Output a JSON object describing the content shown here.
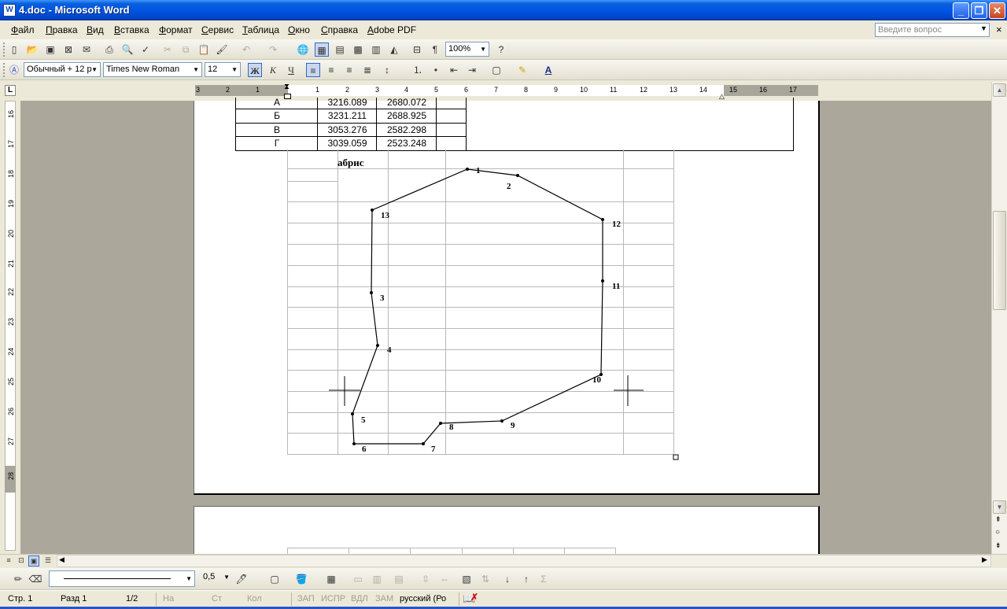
{
  "window": {
    "title": "4.doc - Microsoft Word",
    "icon": "W",
    "controls": [
      "minimize",
      "maximize",
      "close"
    ]
  },
  "menu": {
    "items": [
      "Файл",
      "Правка",
      "Вид",
      "Вставка",
      "Формат",
      "Сервис",
      "Таблица",
      "Окно",
      "Справка",
      "Adobe PDF"
    ],
    "help_placeholder": "Введите вопрос",
    "doc_close": "×"
  },
  "standard_toolbar": {
    "zoom": "100%",
    "icons": [
      "new-icon",
      "open-icon",
      "save-icon",
      "permission-icon",
      "email-icon",
      "print-icon",
      "print-preview-icon",
      "spelling-icon",
      "cut-icon",
      "copy-icon",
      "paste-icon",
      "format-painter-icon",
      "undo-icon",
      "redo-icon",
      "hyperlink-icon",
      "tables-borders-icon",
      "insert-table-icon",
      "insert-excel-icon",
      "columns-icon",
      "drawing-icon",
      "document-map-icon",
      "show-formatting-icon",
      "help-icon"
    ]
  },
  "formatting_toolbar": {
    "style": "Обычный + 12 р",
    "font": "Times New Roman",
    "size": "12",
    "bold": "Ж",
    "italic": "К",
    "underline": "Ч"
  },
  "ruler": {
    "numbers": [
      "3",
      "2",
      "1",
      "1",
      "2",
      "3",
      "4",
      "5",
      "6",
      "7",
      "8",
      "9",
      "10",
      "11",
      "12",
      "13",
      "14",
      "15",
      "16",
      "17"
    ],
    "vertical_numbers": [
      "16",
      "17",
      "18",
      "19",
      "20",
      "21",
      "22",
      "23",
      "24",
      "25",
      "26",
      "27",
      "28"
    ],
    "corner_label": "L"
  },
  "coordinates_table": {
    "rows": [
      {
        "point": "А",
        "x": "3216.089",
        "y": "2680.072"
      },
      {
        "point": "Б",
        "x": "3231.211",
        "y": "2688.925"
      },
      {
        "point": "В",
        "x": "3053.276",
        "y": "2582.298"
      },
      {
        "point": "Г",
        "x": "3039.059",
        "y": "2523.248"
      }
    ]
  },
  "abris": {
    "label": "абрис",
    "points": [
      {
        "label": "1"
      },
      {
        "label": "2"
      },
      {
        "label": "12"
      },
      {
        "label": "11"
      },
      {
        "label": "10"
      },
      {
        "label": "9"
      },
      {
        "label": "8"
      },
      {
        "label": "7"
      },
      {
        "label": "6"
      },
      {
        "label": "5"
      },
      {
        "label": "4"
      },
      {
        "label": "3"
      },
      {
        "label": "13"
      }
    ]
  },
  "drawing_toolbar": {
    "line_width": "0,5",
    "sigma": "Σ"
  },
  "status": {
    "page": "Стр. 1",
    "section": "Разд 1",
    "pages": "1/2",
    "at": "На",
    "line": "Ст",
    "col": "Кол",
    "rec": "ЗАП",
    "trk": "ИСПР",
    "ext": "ВДЛ",
    "ovr": "ЗАМ",
    "language": "русский (Ро"
  }
}
